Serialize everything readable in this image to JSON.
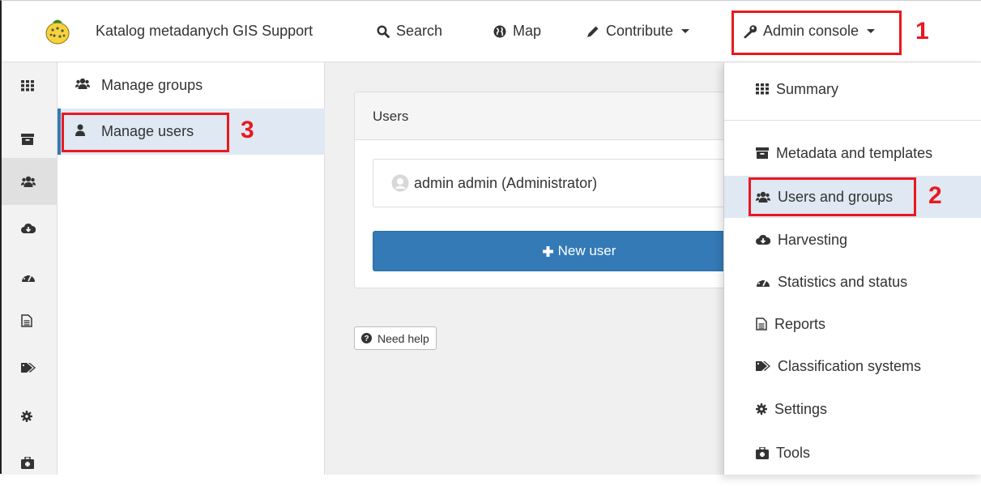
{
  "navbar": {
    "brand": "Katalog metadanych GIS Support",
    "search": "Search",
    "map": "Map",
    "contribute": "Contribute",
    "admin_console": "Admin console"
  },
  "markers": {
    "m1": "1",
    "m2": "2",
    "m3": "3"
  },
  "rail": {
    "items": [
      {
        "icon": "grid-icon"
      },
      {
        "icon": "archive-icon"
      },
      {
        "icon": "users-icon",
        "active": true
      },
      {
        "icon": "cloud-download-icon"
      },
      {
        "icon": "dashboard-icon"
      },
      {
        "icon": "file-icon"
      },
      {
        "icon": "tags-icon"
      },
      {
        "icon": "gear-icon"
      },
      {
        "icon": "toolbox-icon"
      }
    ]
  },
  "subnav": {
    "manage_groups": "Manage groups",
    "manage_users": "Manage users"
  },
  "main": {
    "panel_title": "Users",
    "user_entry": "admin admin (Administrator)",
    "new_user": "New user",
    "need_help": "Need help"
  },
  "dropdown": {
    "summary": "Summary",
    "metadata_templates": "Metadata and templates",
    "users_groups": "Users and groups",
    "harvesting": "Harvesting",
    "statistics_status": "Statistics and status",
    "reports": "Reports",
    "classification_systems": "Classification systems",
    "settings": "Settings",
    "tools": "Tools"
  },
  "colors": {
    "accent": "#337ab7",
    "highlight": "#e8191f",
    "active_bg": "#dfe8f3"
  }
}
